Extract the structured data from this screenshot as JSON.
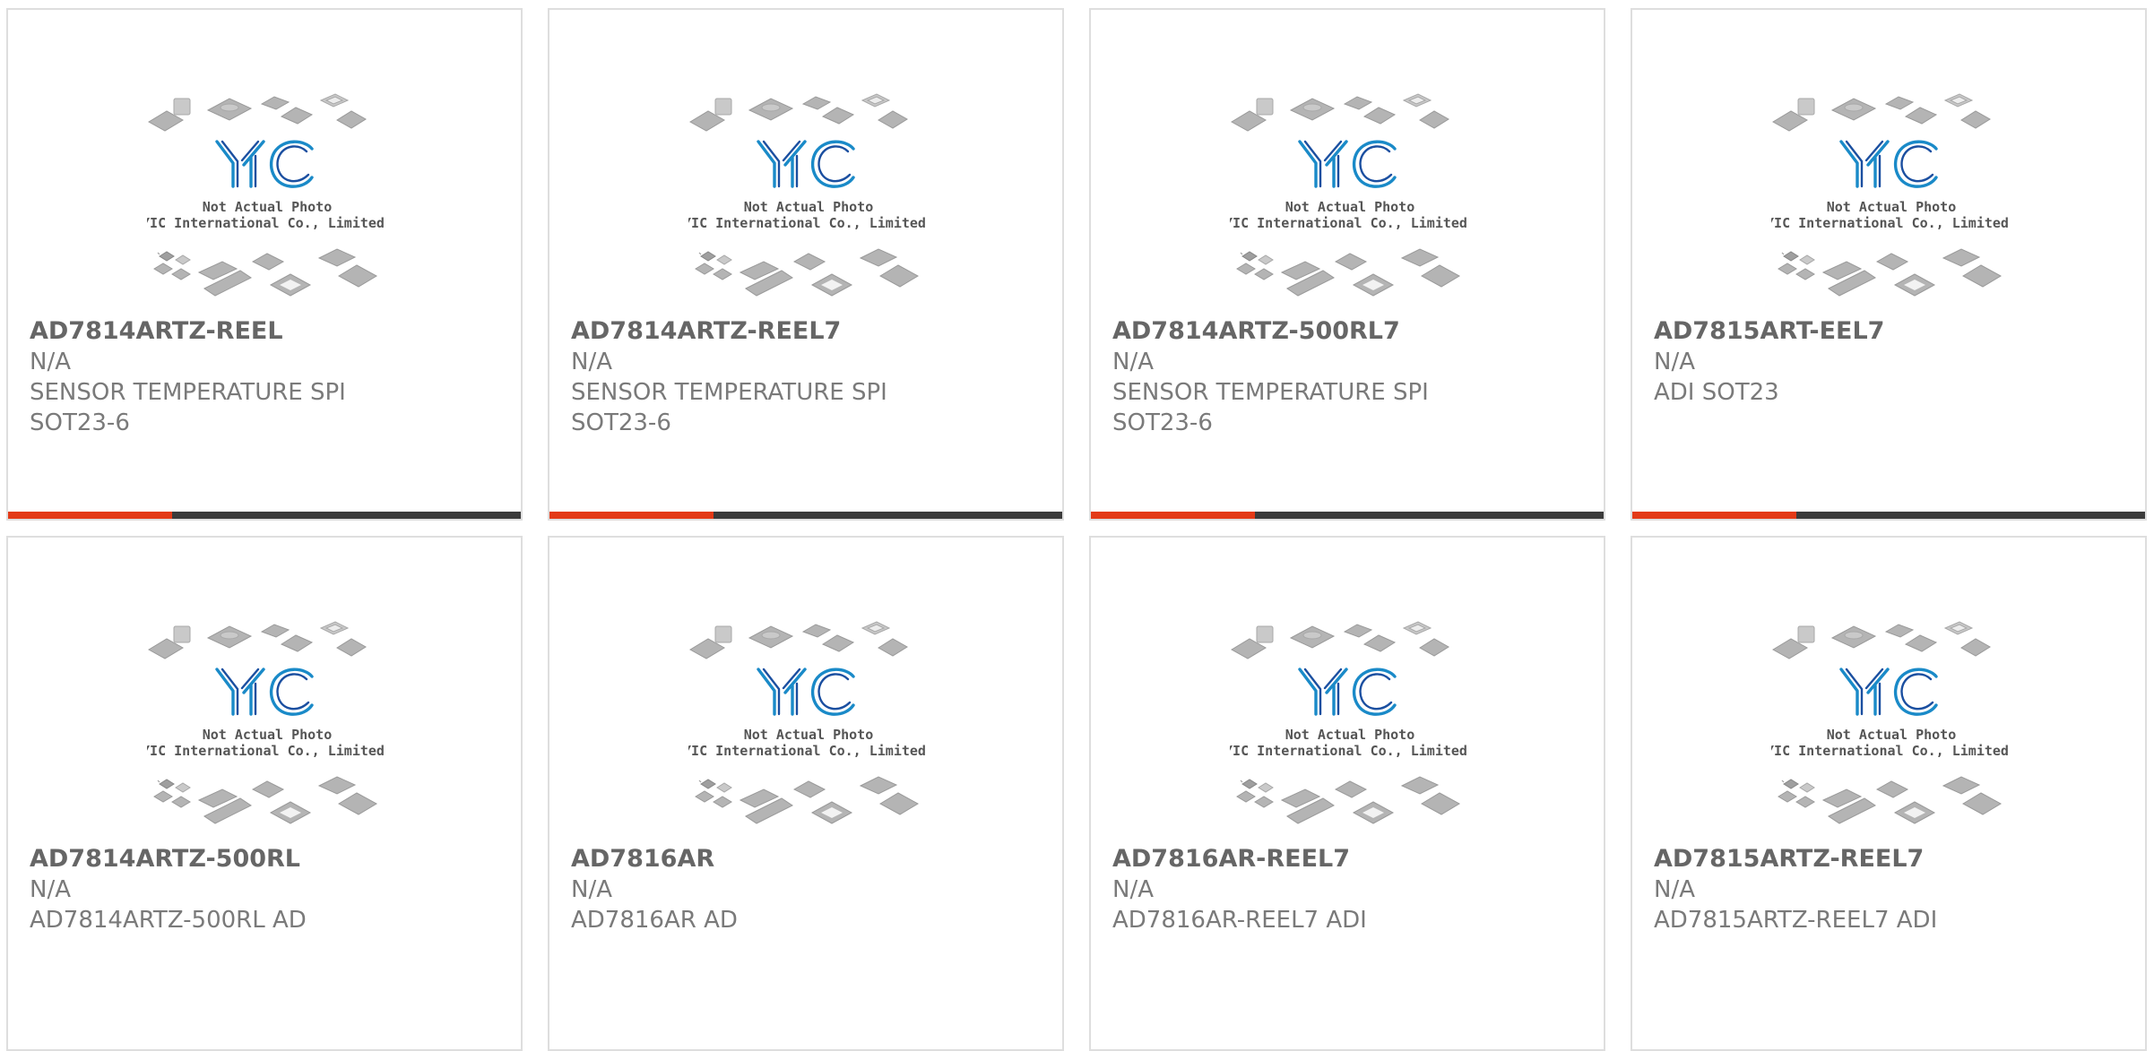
{
  "thumbnail": {
    "brand": "YIC",
    "caption_line1": "Not Actual Photo",
    "caption_line2": "YIC International Co., Limited.",
    "icon": "component-placeholder-image"
  },
  "colors": {
    "accent": "#e33a17",
    "bar": "#3b3b3b",
    "border": "#dedede",
    "title": "#666666",
    "text": "#7a7a7a",
    "logo_light": "#1a8ac8",
    "logo_dark": "#1b4fa0"
  },
  "products": [
    {
      "part_number": "AD7814ARTZ-REEL",
      "lines": [
        "N/A",
        "SENSOR TEMPERATURE SPI",
        "SOT23-6"
      ]
    },
    {
      "part_number": "AD7814ARTZ-REEL7",
      "lines": [
        "N/A",
        "SENSOR TEMPERATURE SPI",
        "SOT23-6"
      ]
    },
    {
      "part_number": "AD7814ARTZ-500RL7",
      "lines": [
        "N/A",
        "SENSOR TEMPERATURE SPI",
        "SOT23-6"
      ]
    },
    {
      "part_number": "AD7815ART-EEL7",
      "lines": [
        "N/A",
        "ADI SOT23"
      ]
    },
    {
      "part_number": "AD7814ARTZ-500RL",
      "lines": [
        "N/A",
        "AD7814ARTZ-500RL AD"
      ]
    },
    {
      "part_number": "AD7816AR",
      "lines": [
        "N/A",
        "AD7816AR AD"
      ]
    },
    {
      "part_number": "AD7816AR-REEL7",
      "lines": [
        "N/A",
        "AD7816AR-REEL7 ADI"
      ]
    },
    {
      "part_number": "AD7815ARTZ-REEL7",
      "lines": [
        "N/A",
        "AD7815ARTZ-REEL7 ADI"
      ]
    }
  ]
}
